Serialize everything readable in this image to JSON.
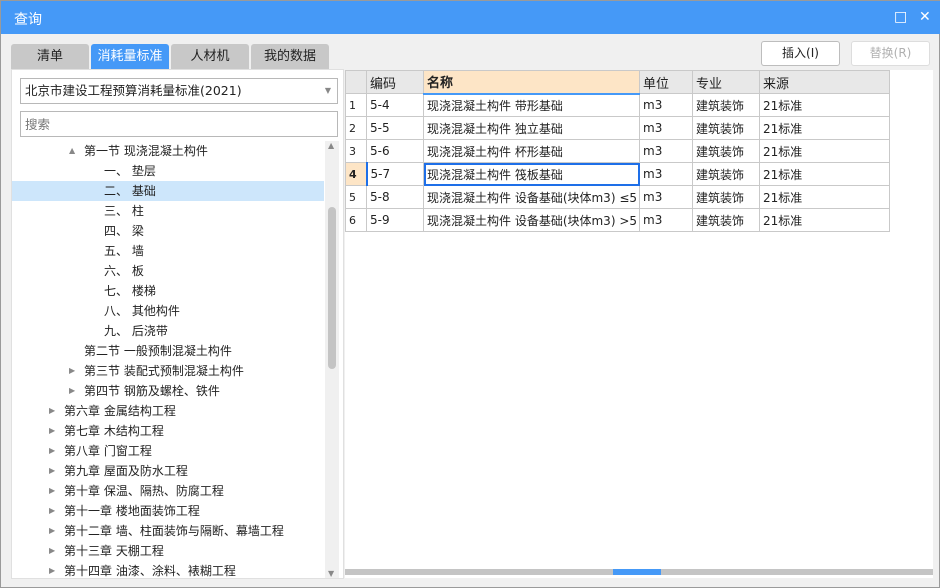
{
  "window": {
    "title": "查询",
    "maximize_icon": "□",
    "close_icon": "✕"
  },
  "tabs": [
    {
      "label": "清单"
    },
    {
      "label": "消耗量标准"
    },
    {
      "label": "人材机"
    },
    {
      "label": "我的数据"
    }
  ],
  "buttons": {
    "insert": "插入(I)",
    "replace": "替换(R)"
  },
  "left": {
    "standard": "北京市建设工程预算消耗量标准(2021)",
    "search_placeholder": "搜索"
  },
  "tree": [
    {
      "label": "第一节 现浇混凝土构件",
      "level": 1,
      "arrow": "▲"
    },
    {
      "label": "一、 垫层",
      "level": 2
    },
    {
      "label": "二、 基础",
      "level": 2,
      "selected": true
    },
    {
      "label": "三、 柱",
      "level": 2
    },
    {
      "label": "四、 梁",
      "level": 2
    },
    {
      "label": "五、 墙",
      "level": 2
    },
    {
      "label": "六、 板",
      "level": 2
    },
    {
      "label": "七、 楼梯",
      "level": 2
    },
    {
      "label": "八、 其他构件",
      "level": 2
    },
    {
      "label": "九、 后浇带",
      "level": 2
    },
    {
      "label": "第二节 一般预制混凝土构件",
      "level": 1
    },
    {
      "label": "第三节 装配式预制混凝土构件",
      "level": 1,
      "arrow": "▶"
    },
    {
      "label": "第四节 钢筋及螺栓、铁件",
      "level": 1,
      "arrow": "▶"
    },
    {
      "label": "第六章 金属结构工程",
      "level": 0,
      "arrow": "▶"
    },
    {
      "label": "第七章 木结构工程",
      "level": 0,
      "arrow": "▶"
    },
    {
      "label": "第八章 门窗工程",
      "level": 0,
      "arrow": "▶"
    },
    {
      "label": "第九章 屋面及防水工程",
      "level": 0,
      "arrow": "▶"
    },
    {
      "label": "第十章 保温、隔热、防腐工程",
      "level": 0,
      "arrow": "▶"
    },
    {
      "label": "第十一章 楼地面装饰工程",
      "level": 0,
      "arrow": "▶"
    },
    {
      "label": "第十二章 墙、柱面装饰与隔断、幕墙工程",
      "level": 0,
      "arrow": "▶"
    },
    {
      "label": "第十三章 天棚工程",
      "level": 0,
      "arrow": "▶"
    },
    {
      "label": "第十四章 油漆、涂料、裱糊工程",
      "level": 0,
      "arrow": "▶"
    }
  ],
  "table": {
    "columns": [
      "",
      "编码",
      "名称",
      "单位",
      "专业",
      "来源"
    ],
    "rows": [
      [
        "1",
        "5-4",
        "现浇混凝土构件 带形基础",
        "m3",
        "建筑装饰",
        "21标准"
      ],
      [
        "2",
        "5-5",
        "现浇混凝土构件 独立基础",
        "m3",
        "建筑装饰",
        "21标准"
      ],
      [
        "3",
        "5-6",
        "现浇混凝土构件 杯形基础",
        "m3",
        "建筑装饰",
        "21标准"
      ],
      [
        "4",
        "5-7",
        "现浇混凝土构件 筏板基础",
        "m3",
        "建筑装饰",
        "21标准"
      ],
      [
        "5",
        "5-8",
        "现浇混凝土构件 设备基础(块体m3) ≤5",
        "m3",
        "建筑装饰",
        "21标准"
      ],
      [
        "6",
        "5-9",
        "现浇混凝土构件 设备基础(块体m3) >5",
        "m3",
        "建筑装饰",
        "21标准"
      ]
    ],
    "current_row": 3
  }
}
